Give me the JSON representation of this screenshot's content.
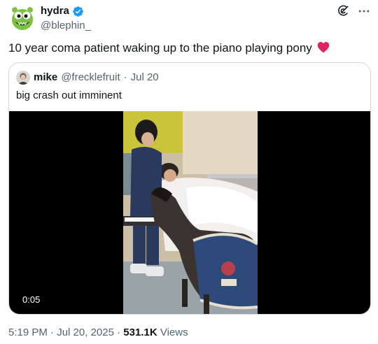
{
  "author": {
    "display_name": "hydra",
    "handle": "@blephin_",
    "verified": true
  },
  "tweet": {
    "text": "10 year coma patient waking up to the piano playing pony",
    "emoji": "red-heart"
  },
  "quote": {
    "display_name": "mike",
    "handle": "@frecklefruit",
    "separator": "·",
    "date": "Jul 20",
    "text": "big crash out imminent",
    "video_time": "0:05"
  },
  "meta": {
    "time": "5:19 PM",
    "separator1": "·",
    "date": "Jul 20, 2025",
    "separator2": "·",
    "views_count": "531.1K",
    "views_label": "Views"
  },
  "colors": {
    "text_primary": "#0f1419",
    "text_secondary": "#536471",
    "border": "#cfd9de",
    "verified_blue": "#1d9bf0",
    "heart_red": "#e0245e"
  }
}
